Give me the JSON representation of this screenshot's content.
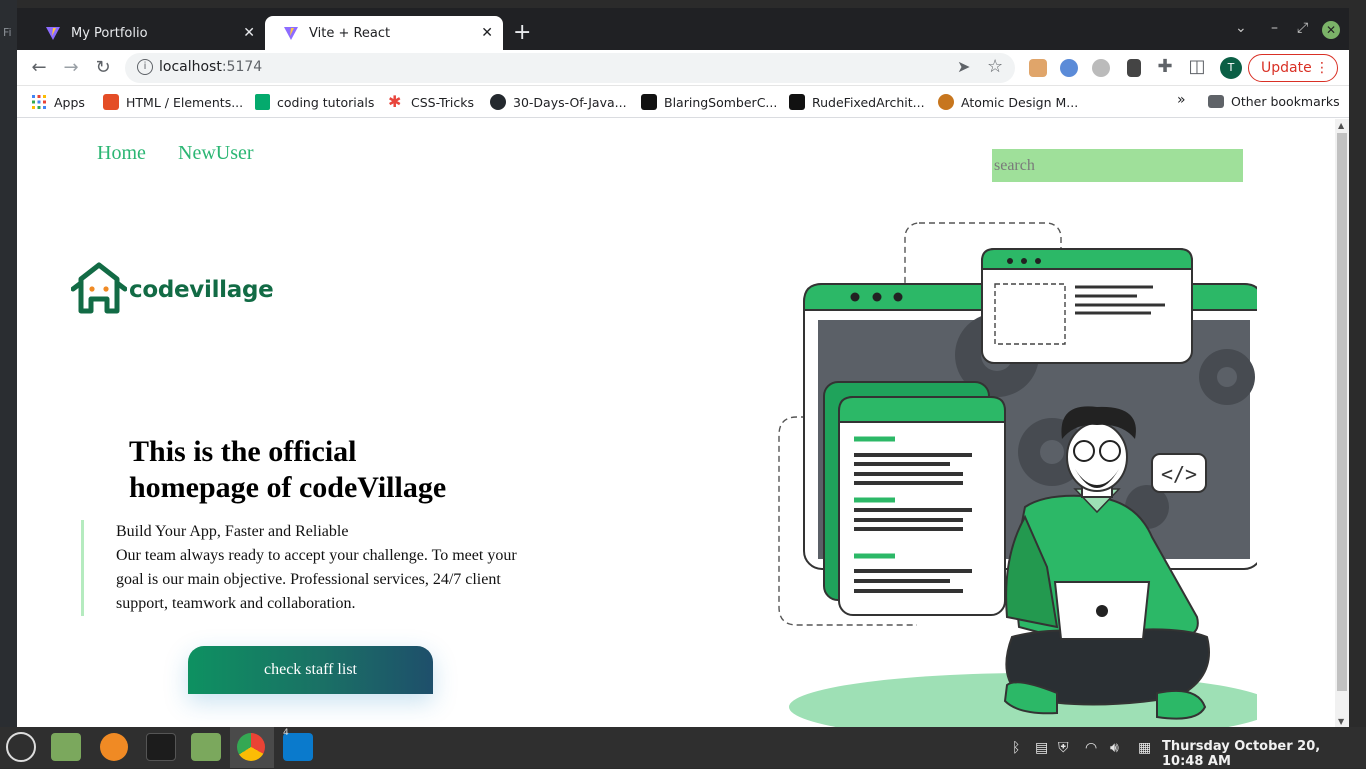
{
  "browser": {
    "tabs": [
      {
        "title": "My Portfolio",
        "active": false
      },
      {
        "title": "Vite + React",
        "active": true
      }
    ],
    "address": {
      "host": "localhost",
      "port": ":5174"
    },
    "update_label": "Update",
    "profile_initial": "T",
    "bookmarks": [
      {
        "label": "Apps"
      },
      {
        "label": "HTML / Elements..."
      },
      {
        "label": "coding tutorials"
      },
      {
        "label": "CSS-Tricks"
      },
      {
        "label": "30-Days-Of-Java..."
      },
      {
        "label": "BlaringSomberC..."
      },
      {
        "label": "RudeFixedArchit..."
      },
      {
        "label": "Atomic Design M..."
      }
    ],
    "bookmarks_overflow": "»",
    "other_bookmarks": "Other bookmarks"
  },
  "page": {
    "nav": [
      {
        "label": "Home"
      },
      {
        "label": "NewUser"
      }
    ],
    "search_placeholder": "search",
    "logo_text": "codevillage",
    "headline": "This is the official homepage of codeVillage",
    "tagline": "Build Your App, Faster and Reliable",
    "description": "Our team always ready to accept your challenge. To meet your goal is our main objective. Professional services, 24/7 client support, teamwork and collaboration.",
    "cta_label": "check staff list",
    "code_tag": "</>"
  },
  "colors": {
    "accent_green": "#2bb673",
    "search_bg": "#9fe09a",
    "logo_green": "#126b45"
  },
  "taskbar": {
    "vscode_badge": "4",
    "clock": "Thursday October 20, 10:48 AM"
  }
}
